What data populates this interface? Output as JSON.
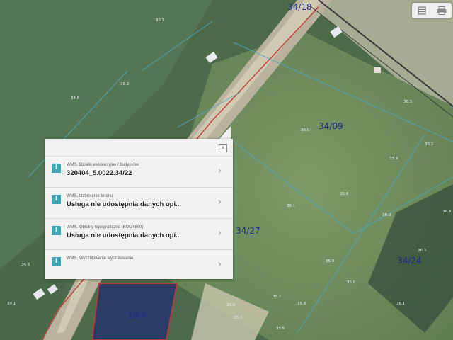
{
  "map": {
    "parcels": {
      "top": "34/18",
      "right_field": "34/09",
      "center": "34/27",
      "lower_right": "34/24",
      "bottom": "1/64"
    }
  },
  "toolbar": {
    "icons": [
      "layers-icon",
      "print-icon"
    ]
  },
  "popup": {
    "close_label": "×",
    "items": [
      {
        "title": "WMS, Działki ewidencyjne / budynków",
        "value": "320404_5.0022.34/22"
      },
      {
        "title": "WMS, Uzbrojenie terenu",
        "value": "Usługa nie udostępnia danych opi..."
      },
      {
        "title": "WMS, Obiekty topograficzne (BDOT500)",
        "value": "Usługa nie udostępnia danych opi..."
      },
      {
        "title": "WMS, Wyszukiwanie wyszukiwanie",
        "value": ""
      }
    ]
  }
}
